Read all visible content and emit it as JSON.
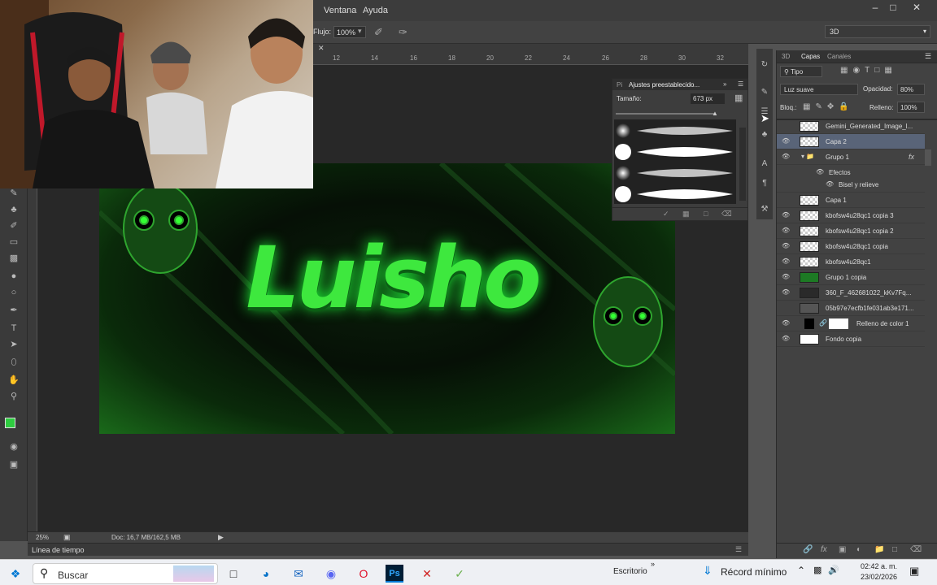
{
  "menu": {
    "ventana": "Ventana",
    "ayuda": "Ayuda"
  },
  "options": {
    "flujo_label": "Flujo:",
    "flujo_value": "100%",
    "workspace": "3D"
  },
  "ruler_ticks": [
    "12",
    "14",
    "16",
    "18",
    "20",
    "22",
    "24",
    "26",
    "28",
    "30",
    "32"
  ],
  "canvas_text": "Luisho",
  "status": {
    "zoom": "25%",
    "doc": "Doc: 16,7 MB/162,5 MB"
  },
  "timeline_label": "Línea de tiempo",
  "presets": {
    "tab_short": "Pi",
    "title": "Ajustes preestablecido...",
    "size_label": "Tamaño:",
    "size_value": "673 px"
  },
  "layers_panel": {
    "tabs": [
      "3D",
      "Capas",
      "Canales"
    ],
    "kind_label": "Tipo",
    "blend_mode": "Luz suave",
    "opacity_label": "Opacidad:",
    "opacity_value": "80%",
    "lock_label": "Bloq.:",
    "fill_label": "Relleno:",
    "fill_value": "100%",
    "layers": [
      {
        "name": "Gemini_Generated_Image_l...",
        "visible": false
      },
      {
        "name": "Capa 2",
        "visible": true
      },
      {
        "name": "Grupo 1",
        "visible": true
      },
      {
        "name": "Efectos",
        "visible": true
      },
      {
        "name": "Bisel y relieve",
        "visible": true
      },
      {
        "name": "Capa 1",
        "visible": false
      },
      {
        "name": "kbofsw4u28qc1 copia 3",
        "visible": true
      },
      {
        "name": "kbofsw4u28qc1 copia 2",
        "visible": true
      },
      {
        "name": "kbofsw4u28qc1 copia",
        "visible": true
      },
      {
        "name": "kbofsw4u28qc1",
        "visible": true
      },
      {
        "name": "Grupo 1 copia",
        "visible": true
      },
      {
        "name": "360_F_462681022_kKv7Fq...",
        "visible": true
      },
      {
        "name": "05b97e7ecfb1fe031ab3e171...",
        "visible": false
      },
      {
        "name": "Relleno de color 1",
        "visible": true
      },
      {
        "name": "Fondo copia",
        "visible": true
      }
    ]
  },
  "taskbar": {
    "search_placeholder": "Buscar",
    "desktop_label": "Escritorio",
    "weather_text": "Récord mínimo",
    "time": "02:42 a. m.",
    "date": "23/02/2026"
  },
  "colors": {
    "accent_green": "#2ecc40",
    "selected_row": "#596478"
  }
}
